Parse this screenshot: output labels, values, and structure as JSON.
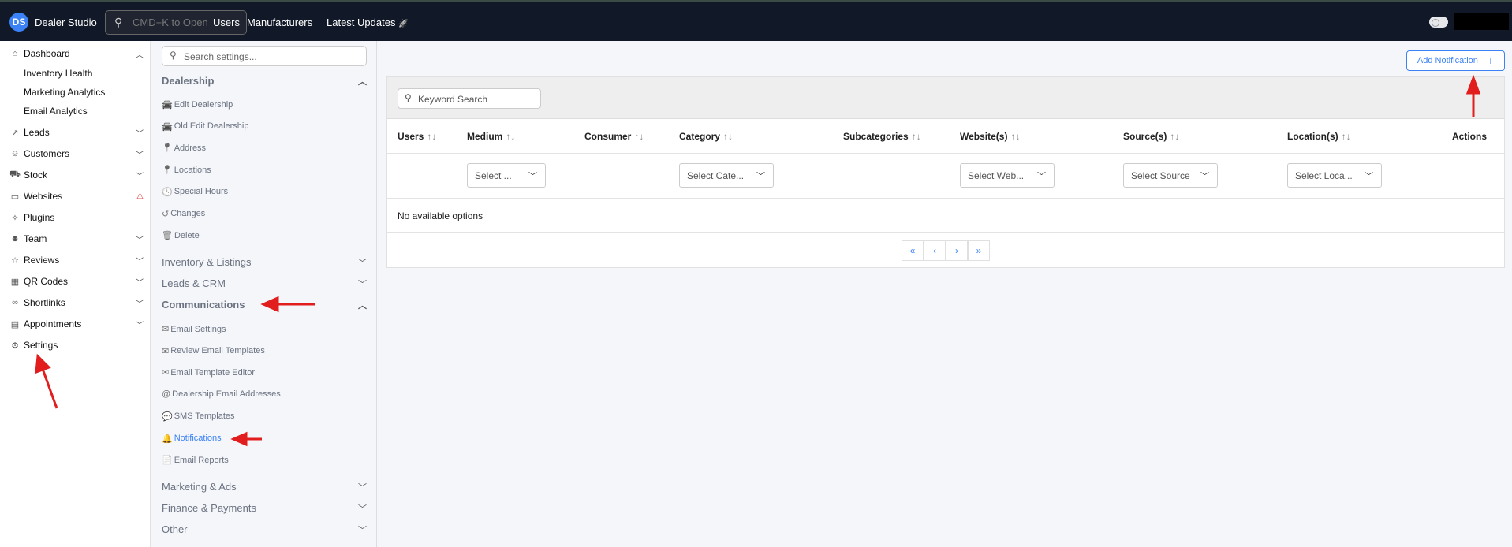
{
  "header": {
    "logo": "DS",
    "brand": "Dealer Studio",
    "search_placeholder": "CMD+K to Open",
    "nav": [
      "Users",
      "Manufacturers",
      "Latest Updates"
    ],
    "rocket": "🚀"
  },
  "sidebar": {
    "items": [
      {
        "label": "Dashboard",
        "icon": "⌂",
        "chev": "︿"
      },
      {
        "label": "Inventory Health",
        "sub": true
      },
      {
        "label": "Marketing Analytics",
        "sub": true
      },
      {
        "label": "Email Analytics",
        "sub": true
      },
      {
        "label": "Leads",
        "icon": "↗",
        "chev": "﹀"
      },
      {
        "label": "Customers",
        "icon": "☺",
        "chev": "﹀"
      },
      {
        "label": "Stock",
        "icon": "⛟",
        "chev": "﹀"
      },
      {
        "label": "Websites",
        "icon": "▭",
        "chev": "⚠"
      },
      {
        "label": "Plugins",
        "icon": "✧"
      },
      {
        "label": "Team",
        "icon": "☻",
        "chev": "﹀"
      },
      {
        "label": "Reviews",
        "icon": "☆",
        "chev": "﹀"
      },
      {
        "label": "QR Codes",
        "icon": "▦",
        "chev": "﹀"
      },
      {
        "label": "Shortlinks",
        "icon": "∞",
        "chev": "﹀"
      },
      {
        "label": "Appointments",
        "icon": "▤",
        "chev": "﹀"
      },
      {
        "label": "Settings",
        "icon": "⚙"
      }
    ]
  },
  "settings": {
    "search_placeholder": "Search settings...",
    "dealership": {
      "title": "Dealership",
      "items": [
        "Edit Dealership",
        "Old Edit Dealership",
        "Address",
        "Locations",
        "Special Hours",
        "Changes",
        "Delete"
      ]
    },
    "collapsed_a": [
      "Inventory & Listings",
      "Leads & CRM"
    ],
    "communications": {
      "title": "Communications",
      "items": [
        "Email Settings",
        "Review Email Templates",
        "Email Template Editor",
        "Dealership Email Addresses",
        "SMS Templates",
        "Notifications",
        "Email Reports"
      ]
    },
    "collapsed_b": [
      "Marketing & Ads",
      "Finance & Payments",
      "Other"
    ]
  },
  "main": {
    "add_button": "Add Notification",
    "keyword_placeholder": "Keyword Search",
    "columns": [
      "Users",
      "Medium",
      "Consumer",
      "Category",
      "Subcategories",
      "Website(s)",
      "Source(s)",
      "Location(s)",
      "Actions"
    ],
    "filters": [
      "Select ...",
      "Select Cate...",
      "Select Web...",
      "Select Source",
      "Select Loca..."
    ],
    "empty": "No available options",
    "pagination": [
      "«",
      "‹",
      "›",
      "»"
    ]
  },
  "colors": {
    "accent": "#3b82f6",
    "topbar": "#111827",
    "annotation": "#e11d1d"
  }
}
